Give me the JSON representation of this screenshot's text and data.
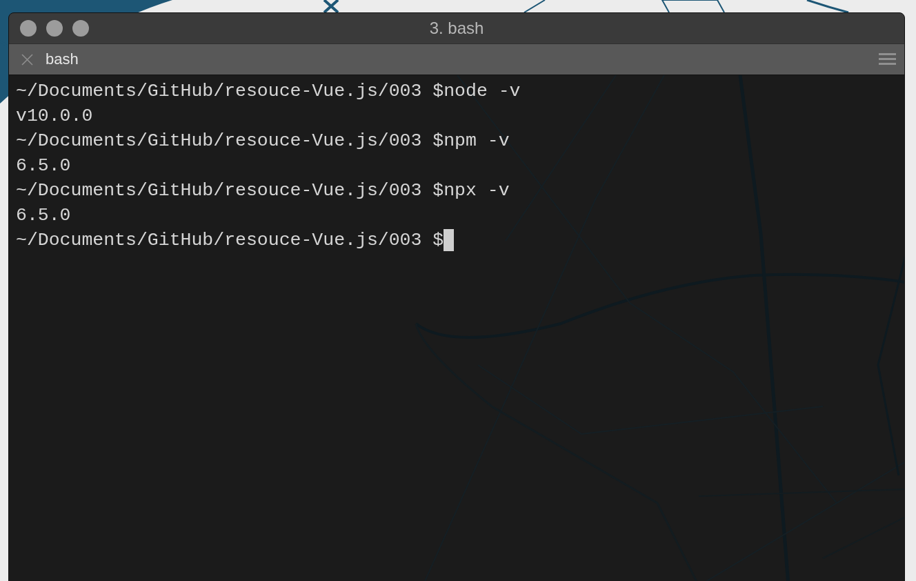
{
  "window": {
    "title": "3. bash"
  },
  "tab": {
    "label": "bash"
  },
  "lines": [
    {
      "kind": "output",
      "text": "~/Documents/GitHub/resouce-Vue.js/003 $node -v"
    },
    {
      "kind": "output",
      "text": "v10.0.0"
    },
    {
      "kind": "output",
      "text": "~/Documents/GitHub/resouce-Vue.js/003 $npm -v"
    },
    {
      "kind": "output",
      "text": "6.5.0"
    },
    {
      "kind": "output",
      "text": "~/Documents/GitHub/resouce-Vue.js/003 $npx -v"
    },
    {
      "kind": "output",
      "text": "6.5.0"
    },
    {
      "kind": "input",
      "text": "~/Documents/GitHub/resouce-Vue.js/003 $"
    }
  ]
}
